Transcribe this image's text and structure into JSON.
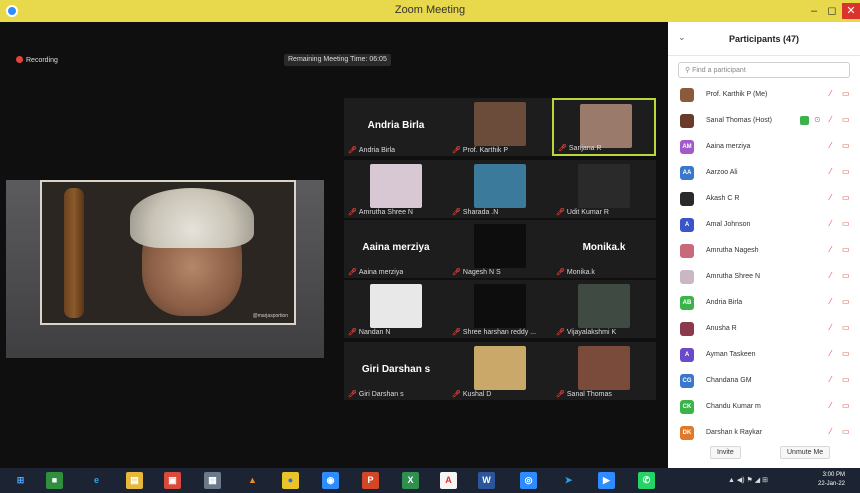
{
  "window": {
    "title": "Zoom Meeting",
    "minimize": "–",
    "maximize": "◻",
    "close": "✕"
  },
  "meeting": {
    "recording_label": "Recording",
    "remaining_time": "Remaining Meeting Time: 06:05",
    "shared_watermark": "@marjasportion",
    "tiles": [
      {
        "big": "Andria Birla",
        "label": "Andria Birla",
        "photo": ""
      },
      {
        "big": "",
        "label": "Prof. Karthik P",
        "photo": "#6b4b3a"
      },
      {
        "big": "",
        "label": "Sanjana R",
        "photo": "#9a7a6a"
      },
      {
        "big": "",
        "label": "Amrutha Shree N",
        "photo": "#d8c8d4"
      },
      {
        "big": "",
        "label": "Sharada .N",
        "photo": "#3b7a9a"
      },
      {
        "big": "",
        "label": "Udit Kumar R",
        "photo": "#2a2a2a"
      },
      {
        "big": "Aaina merziya",
        "label": "Aaina merziya",
        "photo": ""
      },
      {
        "big": "",
        "label": "Nagesh N S",
        "photo": "#0d0d0d"
      },
      {
        "big": "Monika.k",
        "label": "Monika.k",
        "photo": ""
      },
      {
        "big": "",
        "label": "Nandan N",
        "photo": "#e8e8e8"
      },
      {
        "big": "",
        "label": "Shree harshan reddy ...",
        "photo": "#0d0d0d"
      },
      {
        "big": "",
        "label": "Vijayalakshmi K",
        "photo": "#3e4a42"
      },
      {
        "big": "Giri Darshan s",
        "label": "Giri Darshan s",
        "photo": ""
      },
      {
        "big": "",
        "label": "Kushal D",
        "photo": "#c9a86a"
      },
      {
        "big": "",
        "label": "Sanal Thomas",
        "photo": "#7a4a3a"
      }
    ]
  },
  "participants": {
    "title": "Participants (47)",
    "search_placeholder": "Find a participant",
    "list": [
      {
        "name": "Prof. Karthik P (Me)",
        "initials": "",
        "color": "#8a5a3a"
      },
      {
        "name": "Sanal Thomas (Host)",
        "initials": "",
        "color": "#6a3a2a",
        "video": true
      },
      {
        "name": "Aaina merziya",
        "initials": "AM",
        "color": "#a35ac9"
      },
      {
        "name": "Aarzoo Ali",
        "initials": "AA",
        "color": "#3a78c9"
      },
      {
        "name": "Akash C R",
        "initials": "",
        "color": "#2a2a2a"
      },
      {
        "name": "Amal Johnson",
        "initials": "A",
        "color": "#3a55c9"
      },
      {
        "name": "Amrutha Nagesh",
        "initials": "",
        "color": "#c96a7a"
      },
      {
        "name": "Amrutha Shree N",
        "initials": "",
        "color": "#c9b8c4"
      },
      {
        "name": "Andria Birla",
        "initials": "AB",
        "color": "#3ab44a"
      },
      {
        "name": "Anusha R",
        "initials": "",
        "color": "#8a3a4a"
      },
      {
        "name": "Ayman Taskeen",
        "initials": "A",
        "color": "#6a4ac9"
      },
      {
        "name": "Chandana GM",
        "initials": "CG",
        "color": "#3a78c9"
      },
      {
        "name": "Chandu Kumar m",
        "initials": "CK",
        "color": "#3ab44a"
      },
      {
        "name": "Darshan k Raykar",
        "initials": "DK",
        "color": "#e07a2a"
      }
    ],
    "invite": "Invite",
    "unmute_me": "Unmute Me"
  },
  "taskbar": {
    "time": "3:00 PM",
    "date": "22-Jan-22",
    "tray": "▲  ◀)  ⚑  ◢  ⊞"
  }
}
